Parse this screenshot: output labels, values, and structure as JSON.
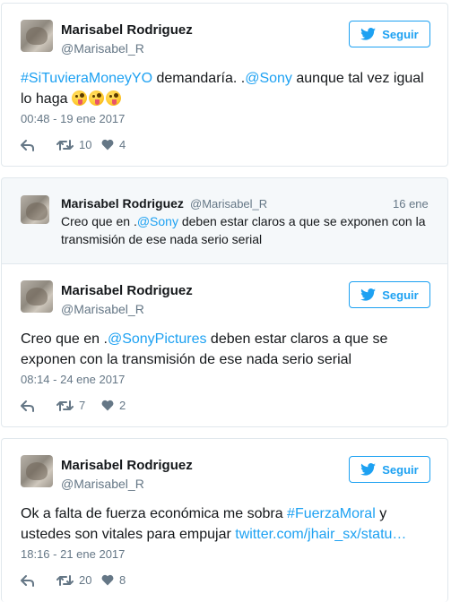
{
  "tweet1": {
    "name": "Marisabel Rodriguez",
    "handle": "@Marisabel_R",
    "follow_label": "Seguir",
    "text_hashtag": "#SiTuvieraMoneyYO",
    "text_part1": " demandaría. .",
    "text_mention": "@Sony",
    "text_part2": " aunque tal vez igual lo haga ",
    "emojis": [
      "winking-tongue-face",
      "winking-tongue-face",
      "winking-tongue-face"
    ],
    "timestamp": "00:48 - 19 ene 2017",
    "retweets": "10",
    "likes": "4"
  },
  "quoted": {
    "name": "Marisabel Rodriguez",
    "handle": "@Marisabel_R",
    "date": "16 ene",
    "text_part1": "Creo que en .",
    "text_mention": "@Sony",
    "text_part2": " deben estar claros a que se exponen con la transmisión de ese nada serio serial"
  },
  "tweet2": {
    "name": "Marisabel Rodriguez",
    "handle": "@Marisabel_R",
    "follow_label": "Seguir",
    "text_part1": "Creo que en .",
    "text_mention": "@SonyPictures",
    "text_part2": " deben estar claros a que se exponen con la transmisión de ese nada serio serial",
    "timestamp": "08:14 - 24 ene 2017",
    "retweets": "7",
    "likes": "2"
  },
  "tweet3": {
    "name": "Marisabel Rodriguez",
    "handle": "@Marisabel_R",
    "follow_label": "Seguir",
    "text_part1": "Ok a falta de fuerza económica me sobra ",
    "text_hashtag": "#FuerzaMoral",
    "text_part2": " y ustedes son vitales para empujar ",
    "text_link": "twitter.com/jhair_sx/statu…",
    "timestamp": "18:16 - 21 ene 2017",
    "retweets": "20",
    "likes": "8"
  },
  "colors": {
    "accent": "#1da1f2",
    "muted": "#657786",
    "border": "#e1e8ed",
    "quoted_bg": "#f5f8fa"
  }
}
